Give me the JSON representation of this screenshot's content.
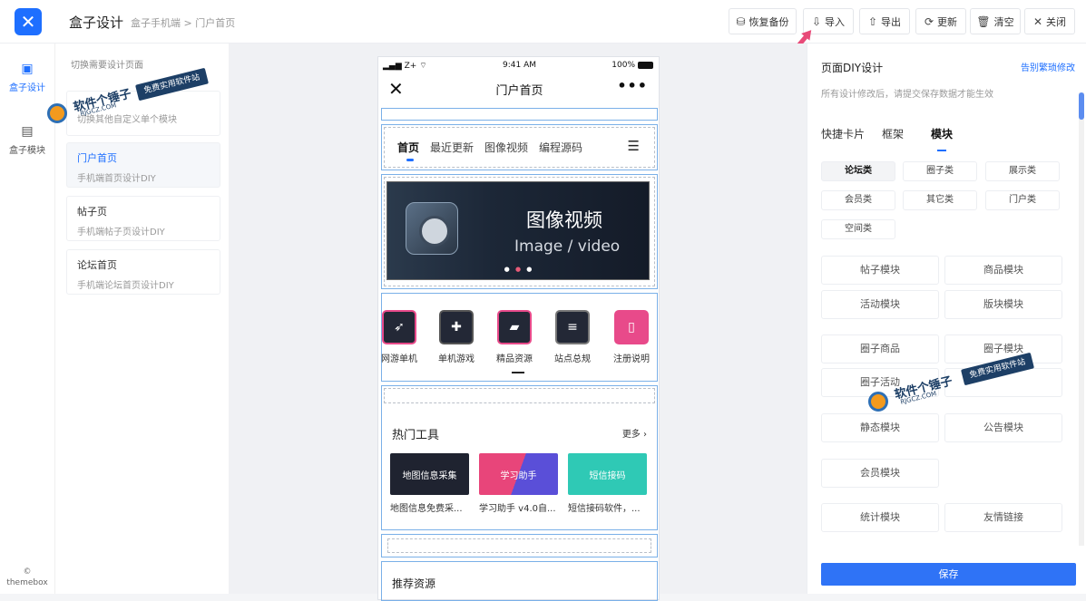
{
  "topbar": {
    "app_title": "盒子设计",
    "breadcrumb": "盒子手机端 > 门户首页",
    "buttons": {
      "restore": "恢复备份",
      "import": "导入",
      "export": "导出",
      "update": "更新",
      "clear": "清空",
      "close": "关闭"
    }
  },
  "sidebar": {
    "items": [
      {
        "label": "盒子设计",
        "icon": "design-icon"
      },
      {
        "label": "盒子模块",
        "icon": "module-icon"
      }
    ],
    "brand_symbol": "©",
    "brand_name": "themebox"
  },
  "pagelist": {
    "heading": "切换需要设计页面",
    "cards": [
      {
        "title": "",
        "subtitle": "切换其他自定义单个模块"
      },
      {
        "title": "门户首页",
        "subtitle": "手机端首页设计DIY"
      },
      {
        "title": "帖子页",
        "subtitle": "手机端帖子页设计DIY"
      },
      {
        "title": "论坛首页",
        "subtitle": "手机端论坛首页设计DIY"
      }
    ]
  },
  "phone": {
    "status": {
      "carrier": "Z+",
      "time": "9:41 AM",
      "battery": "100%"
    },
    "nav_title": "门户首页",
    "close_glyph": "✕",
    "more_glyph": "•••",
    "tabs": [
      "首页",
      "最近更新",
      "图像视频",
      "编程源码"
    ],
    "banner": {
      "title_cn": "图像视频",
      "title_en": "Image / video"
    },
    "grid": [
      "网游单机",
      "单机游戏",
      "精品资源",
      "站点总规",
      "注册说明"
    ],
    "hot": {
      "title": "热门工具",
      "more": "更多",
      "items": [
        {
          "image_text": "地图信息采集",
          "caption": "地图信息免费采...",
          "color": "#1f2330"
        },
        {
          "image_text": "学习助手",
          "caption": "学习助手 v4.0自...",
          "color": "#e8457a"
        },
        {
          "image_text": "短信接码",
          "caption": "短信接码软件，...",
          "color": "#2fc9b5"
        }
      ]
    },
    "recommend_title": "推荐资源"
  },
  "rpanel": {
    "title": "页面DIY设计",
    "link": "告别繁琐修改",
    "hint": "所有设计修改后，请提交保存数据才能生效",
    "tabs": [
      "快捷卡片",
      "框架",
      "模块"
    ],
    "chips": [
      "论坛类",
      "圈子类",
      "展示类",
      "会员类",
      "其它类",
      "门户类",
      "空间类"
    ],
    "modules": [
      "帖子模块",
      "商品模块",
      "活动模块",
      "版块模块",
      "圈子商品",
      "圈子模块",
      "圈子活动",
      "",
      "静态模块",
      "公告模块",
      "会员模块",
      "统计模块",
      "友情链接"
    ],
    "save": "保存"
  },
  "watermark": {
    "main": "软件个锤子",
    "tag": "免费实用软件站",
    "domain": "RJGCZ.COM"
  },
  "colors": {
    "accent": "#1e6fff",
    "save": "#2f73f6",
    "arrow": "#e84a78"
  }
}
